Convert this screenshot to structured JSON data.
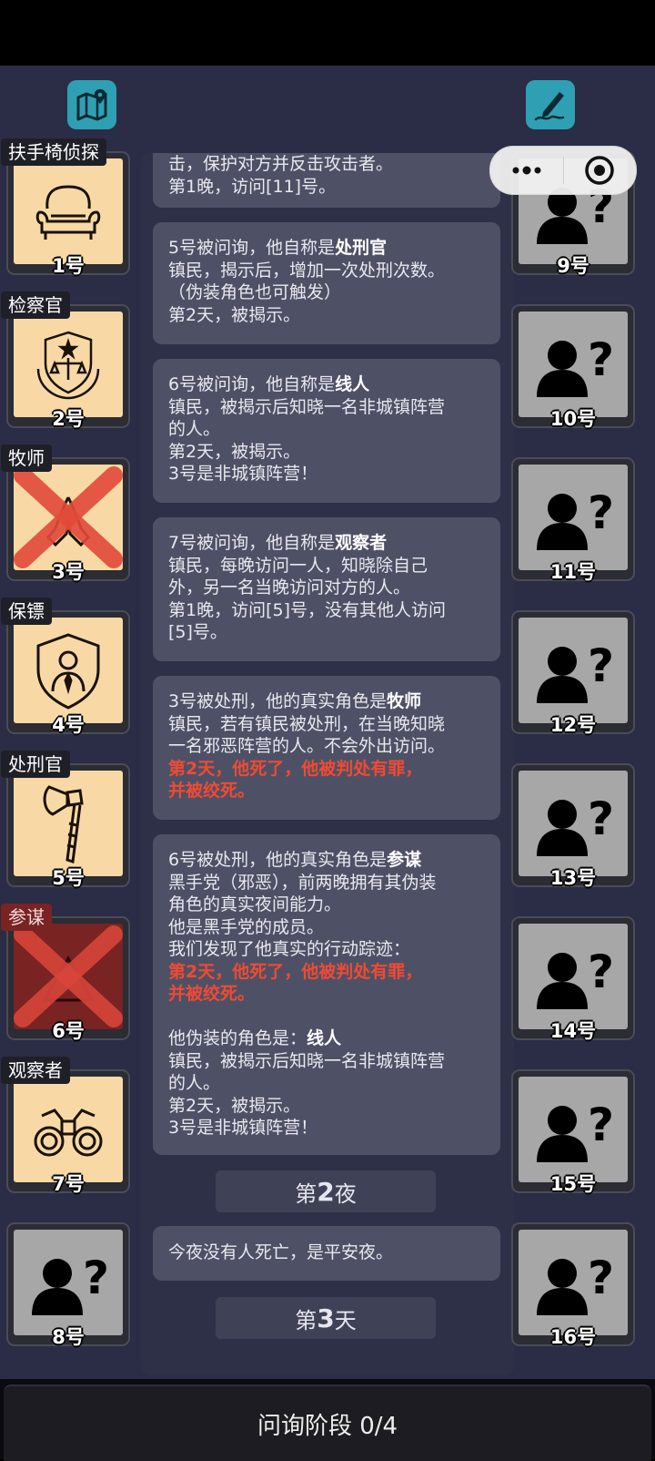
{
  "toolbar": {
    "map_icon": "map-pin-icon",
    "edit_icon": "pencil-icon"
  },
  "capsule": {
    "more_icon": "more-dots-icon",
    "close_icon": "target-circle-icon"
  },
  "left_players": [
    {
      "role": "扶手椅侦探",
      "num": "1号",
      "icon": "armchair-icon",
      "dead": false
    },
    {
      "role": "检察官",
      "num": "2号",
      "icon": "justice-emblem-icon",
      "dead": false
    },
    {
      "role": "牧师",
      "num": "3号",
      "icon": "praying-hands-icon",
      "dead": true
    },
    {
      "role": "保镖",
      "num": "4号",
      "icon": "bodyguard-shield-icon",
      "dead": false
    },
    {
      "role": "处刑官",
      "num": "5号",
      "icon": "axe-icon",
      "dead": false
    },
    {
      "role": "参谋",
      "num": "6号",
      "icon": "unknown-icon",
      "dead": true
    },
    {
      "role": "观察者",
      "num": "7号",
      "icon": "binoculars-icon",
      "dead": false
    },
    {
      "role": "",
      "num": "8号",
      "icon": "unknown-person-icon",
      "dead": false
    }
  ],
  "right_players": [
    "9号",
    "10号",
    "11号",
    "12号",
    "13号",
    "14号",
    "15号",
    "16号"
  ],
  "log": {
    "msg0": {
      "l1": "击，保护对方并反击攻击者。",
      "l2": "第1晚，访问[11]号。"
    },
    "msg1": {
      "l1a": "5号被问询，他自称是",
      "l1b": "处刑官",
      "l2": "镇民，揭示后，增加一次处刑次数。",
      "l3": "（伪装角色也可触发）",
      "l4": "第2天，被揭示。"
    },
    "msg2": {
      "l1a": "6号被问询，他自称是",
      "l1b": "线人",
      "l2": "镇民，被揭示后知晓一名非城镇阵营",
      "l3": "的人。",
      "l4": "第2天，被揭示。",
      "l5": "3号是非城镇阵营！"
    },
    "msg3": {
      "l1a": "7号被问询，他自称是",
      "l1b": "观察者",
      "l2": "镇民，每晚访问一人，知晓除自己",
      "l3": "外，另一名当晚访问对方的人。",
      "l4": "第1晚，访问[5]号，没有其他人访问",
      "l5": "[5]号。"
    },
    "msg4": {
      "l1a": "3号被处刑，他的真实角色是",
      "l1b": "牧师",
      "l2": "镇民，若有镇民被处刑，在当晚知晓",
      "l3": "一名邪恶阵营的人。不会外出访问。",
      "l4": "第2天，他死了，他被判处有罪，",
      "l5": "并被绞死。"
    },
    "msg5": {
      "l1a": "6号被处刑，他的真实角色是",
      "l1b": "参谋",
      "l2": "黑手党（邪恶），前两晚拥有其伪装",
      "l3": "角色的真实夜间能力。",
      "l4": "他是黑手党的成员。",
      "l5": "我们发现了他真实的行动踪迹：",
      "l6": "第2天，他死了，他被判处有罪，",
      "l7": "并被绞死。",
      "l8": "他伪装的角色是：",
      "l8b": "线人",
      "l9": "镇民，被揭示后知晓一名非城镇阵营",
      "l10": "的人。",
      "l11": "第2天，被揭示。",
      "l12": "3号是非城镇阵营！"
    },
    "night2": {
      "pre": "第",
      "num": "2",
      "post": "夜"
    },
    "msg6": {
      "l1": "今夜没有人死亡，是平安夜。"
    },
    "day3": {
      "pre": "第",
      "num": "3",
      "post": "天"
    }
  },
  "phase": {
    "label": "问询阶段 0/4"
  }
}
